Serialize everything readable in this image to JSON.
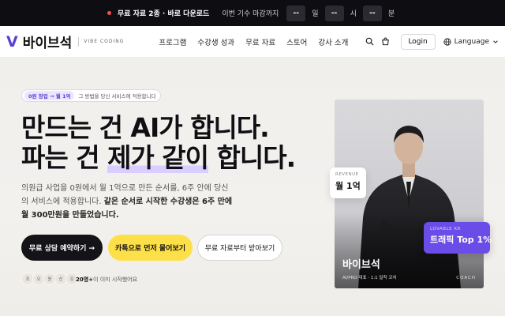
{
  "topbar": {
    "promo": "무료 자료 2종 · 바로 다운로드",
    "deadline_label": "이번 기수 마감까지",
    "countdown": [
      {
        "value": "--",
        "unit": "일"
      },
      {
        "value": "--",
        "unit": "시"
      },
      {
        "value": "--",
        "unit": "분"
      }
    ]
  },
  "header": {
    "logo_mark": "V",
    "logo_text": "바이브석",
    "logo_sub": "VIBE CODING",
    "nav": [
      "프로그램",
      "수강생 성과",
      "무료 자료",
      "스토어",
      "강사 소개"
    ],
    "login": "Login",
    "language": "Language",
    "icons": [
      "search-icon",
      "cart-icon",
      "globe-icon",
      "chevron-down-icon"
    ]
  },
  "hero": {
    "pill_tag": "0원 창업 → 월 1억",
    "pill_text": "그 방법을 당신 서비스에 적용합니다",
    "headline_1": "만드는 건 AI가 합니다.",
    "headline_2a": "파는 건 ",
    "headline_2b": "제가 같이",
    "headline_2c": " 합니다.",
    "desc_plain": "의원급 사업을 0원에서 월 1억으로 만든 순서를, 6주 안에 당신의 서비스에 적용합니다. ",
    "desc_bold": "같은 순서로 시작한 수강생은 6주 만에 월 300만원을 만들었습니다.",
    "btn_primary": "무료 상담 예약하기 →",
    "btn_kakao": "카톡으로 먼저 물어보기",
    "btn_secondary": "무료 자료부터 받아보기",
    "avatars": [
      "조",
      "오",
      "윤",
      "신",
      "김"
    ],
    "social_count": "20명+",
    "social_text": "이 이미 시작했어요"
  },
  "card": {
    "revenue_label": "REVENUE",
    "revenue_value": "월 1억",
    "badge_label": "LOVABLE KR",
    "badge_value": "트래픽 Top 1%",
    "name": "바이브석",
    "subtitle": "AI/PRO 대표 · 1:1 밀착 코치",
    "role": "COACH"
  },
  "colors": {
    "accent": "#5b3fd4",
    "topbar_bg": "#0e0d12",
    "cta_yellow": "#fde047",
    "badge_purple": "#6a4ce8"
  }
}
